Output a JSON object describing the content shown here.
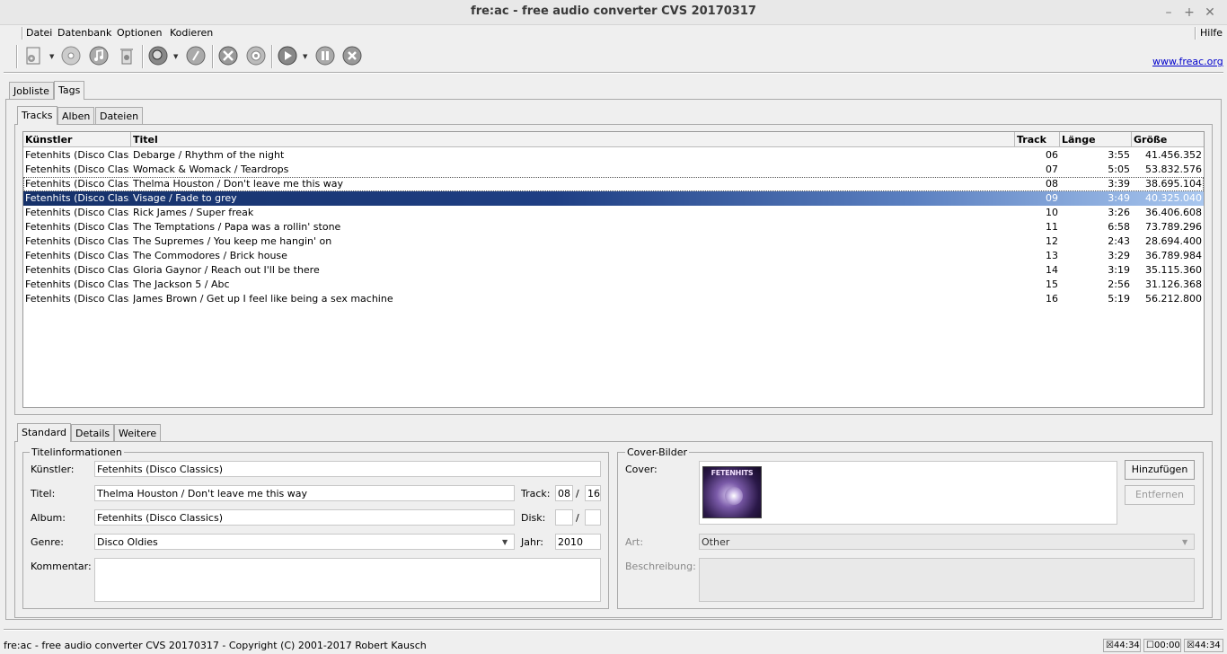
{
  "window": {
    "title": "fre:ac - free audio converter CVS 20170317"
  },
  "menu": {
    "items": [
      "Datei",
      "Datenbank",
      "Optionen",
      "Kodieren"
    ],
    "help": "Hilfe"
  },
  "toolbar": {
    "link": "www.freac.org"
  },
  "main_tabs": [
    "Jobliste",
    "Tags"
  ],
  "sub_tabs": [
    "Tracks",
    "Alben",
    "Dateien"
  ],
  "table": {
    "columns": [
      "Künstler",
      "Titel",
      "Track",
      "Länge",
      "Größe"
    ],
    "rows": [
      {
        "artist": "Fetenhits (Disco Classics)",
        "title": "Debarge / Rhythm of the night",
        "track": "06",
        "length": "3:55",
        "size": "41.456.352"
      },
      {
        "artist": "Fetenhits (Disco Classics)",
        "title": "Womack & Womack / Teardrops",
        "track": "07",
        "length": "5:05",
        "size": "53.832.576"
      },
      {
        "artist": "Fetenhits (Disco Classics)",
        "title": "Thelma Houston / Don't leave me this way",
        "track": "08",
        "length": "3:39",
        "size": "38.695.104"
      },
      {
        "artist": "Fetenhits (Disco Classics)",
        "title": "Visage / Fade to grey",
        "track": "09",
        "length": "3:49",
        "size": "40.325.040"
      },
      {
        "artist": "Fetenhits (Disco Classics)",
        "title": "Rick James / Super freak",
        "track": "10",
        "length": "3:26",
        "size": "36.406.608"
      },
      {
        "artist": "Fetenhits (Disco Classics)",
        "title": "The Temptations / Papa was a rollin' stone",
        "track": "11",
        "length": "6:58",
        "size": "73.789.296"
      },
      {
        "artist": "Fetenhits (Disco Classics)",
        "title": "The Supremes / You keep me hangin' on",
        "track": "12",
        "length": "2:43",
        "size": "28.694.400"
      },
      {
        "artist": "Fetenhits (Disco Classics)",
        "title": "The Commodores / Brick house",
        "track": "13",
        "length": "3:29",
        "size": "36.789.984"
      },
      {
        "artist": "Fetenhits (Disco Classics)",
        "title": "Gloria Gaynor / Reach out I'll be there",
        "track": "14",
        "length": "3:19",
        "size": "35.115.360"
      },
      {
        "artist": "Fetenhits (Disco Classics)",
        "title": "The Jackson 5 / Abc",
        "track": "15",
        "length": "2:56",
        "size": "31.126.368"
      },
      {
        "artist": "Fetenhits (Disco Classics)",
        "title": "James Brown / Get up I feel like being a sex machine",
        "track": "16",
        "length": "5:19",
        "size": "56.212.800"
      }
    ]
  },
  "edit_tabs": [
    "Standard",
    "Details",
    "Weitere"
  ],
  "titleinfo": {
    "group": "Titelinformationen",
    "artist_label": "Künstler:",
    "artist": "Fetenhits (Disco Classics)",
    "title_label": "Titel:",
    "title": "Thelma Houston / Don't leave me this way",
    "album_label": "Album:",
    "album": "Fetenhits (Disco Classics)",
    "genre_label": "Genre:",
    "genre": "Disco Oldies",
    "comment_label": "Kommentar:",
    "track_label": "Track:",
    "track": "08",
    "track_sep": "/",
    "track_total": "16",
    "disc_label": "Disk:",
    "disc_sep": "/",
    "year_label": "Jahr:",
    "year": "2010"
  },
  "cover": {
    "group": "Cover-Bilder",
    "cover_label": "Cover:",
    "add_button": "Hinzufügen",
    "remove_button": "Entfernen",
    "type_label": "Art:",
    "type": "Other",
    "desc_label": "Beschreibung:",
    "art_text": "FETENHITS"
  },
  "status": {
    "text": "fre:ac - free audio converter CVS 20170317 - Copyright (C) 2001-2017 Robert Kausch",
    "time1": "44:34",
    "time2": "00:00",
    "time3": "44:34"
  }
}
